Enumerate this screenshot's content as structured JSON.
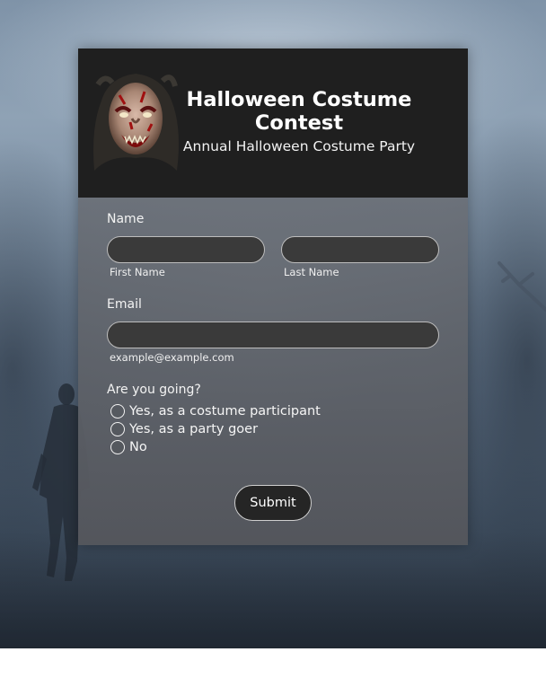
{
  "header": {
    "title": "Halloween Costume Contest",
    "subtitle": "Annual Halloween Costume Party",
    "logo_icon": "monster-mask-icon"
  },
  "form": {
    "name_label": "Name",
    "first_name_value": "",
    "first_name_hint": "First Name",
    "last_name_value": "",
    "last_name_hint": "Last Name",
    "email_label": "Email",
    "email_value": "",
    "email_hint": "example@example.com",
    "going_label": "Are you going?",
    "going_options": [
      "Yes, as a costume participant",
      "Yes, as a party goer",
      "No"
    ],
    "submit_label": "Submit"
  },
  "colors": {
    "header_bg": "#1f1f1f",
    "input_bg": "#3a3a3a",
    "button_bg": "#252525"
  }
}
